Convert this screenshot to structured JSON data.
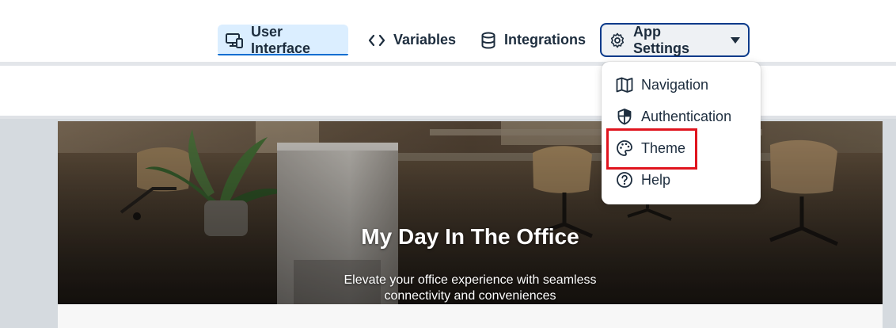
{
  "nav": {
    "tabs": [
      {
        "label": "User Interface",
        "icon": "monitor-phone-icon",
        "selected": true
      },
      {
        "label": "Variables",
        "icon": "code-brackets-icon",
        "selected": false
      },
      {
        "label": "Integrations",
        "icon": "database-icon",
        "selected": false
      },
      {
        "label": "App Settings",
        "icon": "gear-icon",
        "selected": false,
        "open": true
      }
    ]
  },
  "dropdown": {
    "items": [
      {
        "label": "Navigation",
        "icon": "map-icon"
      },
      {
        "label": "Authentication",
        "icon": "shield-icon"
      },
      {
        "label": "Theme",
        "icon": "palette-icon",
        "highlighted": true
      },
      {
        "label": "Help",
        "icon": "help-circle-icon"
      }
    ]
  },
  "hero": {
    "title": "My Day In The Office",
    "subtitle": "Elevate your office experience with seamless connectivity and conveniences"
  },
  "colors": {
    "accent": "#0a6ed1",
    "selected_tab_bg": "#dbeeff",
    "highlight_box": "#e0141e",
    "text": "#1d2d3e"
  }
}
